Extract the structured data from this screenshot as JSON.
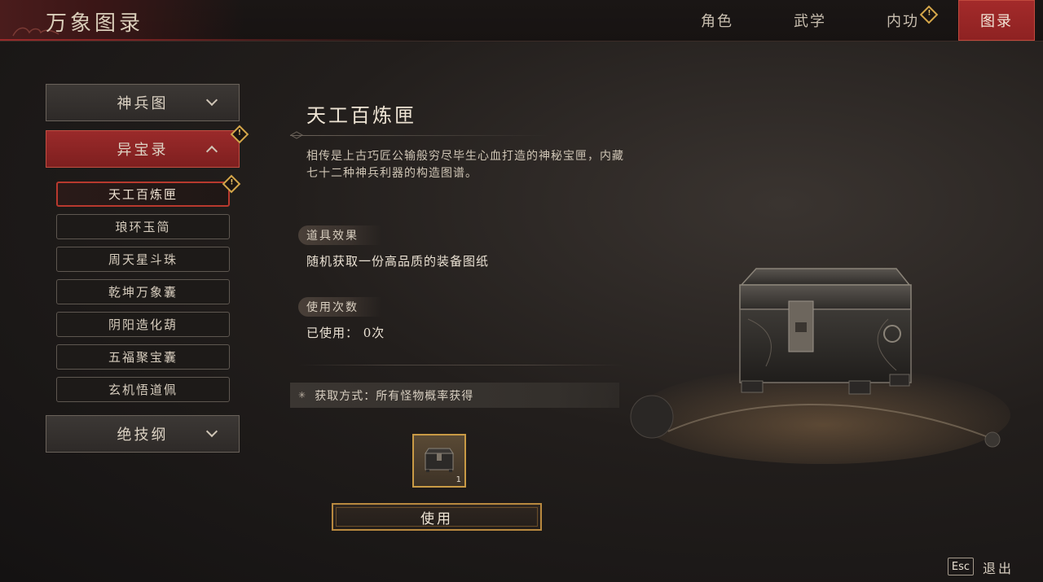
{
  "header": {
    "title": "万象图录",
    "tabs": [
      {
        "label": "角色",
        "active": false,
        "alert": false
      },
      {
        "label": "武学",
        "active": false,
        "alert": false
      },
      {
        "label": "内功",
        "active": false,
        "alert": true
      },
      {
        "label": "图录",
        "active": true,
        "alert": false
      }
    ]
  },
  "sidebar": {
    "categories": [
      {
        "label": "神兵图",
        "expanded": false
      },
      {
        "label": "异宝录",
        "expanded": true,
        "alert": true
      },
      {
        "label": "绝技纲",
        "expanded": false
      }
    ],
    "items": [
      {
        "label": "天工百炼匣",
        "selected": true,
        "alert": true
      },
      {
        "label": "琅环玉简"
      },
      {
        "label": "周天星斗珠"
      },
      {
        "label": "乾坤万象囊"
      },
      {
        "label": "阴阳造化葫"
      },
      {
        "label": "五福聚宝囊"
      },
      {
        "label": "玄机悟道佩"
      }
    ]
  },
  "detail": {
    "name": "天工百炼匣",
    "description": "相传是上古巧匠公输般穷尽毕生心血打造的神秘宝匣，内藏七十二种神兵利器的构造图谱。",
    "effect_label": "道具效果",
    "effect_value": "随机获取一份高品质的装备图纸",
    "uses_label": "使用次数",
    "uses_value": "已使用： 0次",
    "source_text": "获取方式：所有怪物概率获得",
    "slot_count": "1",
    "use_button": "使用"
  },
  "footer": {
    "esc_key": "Esc",
    "exit_label": "退出"
  },
  "colors": {
    "accent_red": "#9a2a2a",
    "gold_border": "#c99a45",
    "alert_gold": "#d4a64a"
  }
}
